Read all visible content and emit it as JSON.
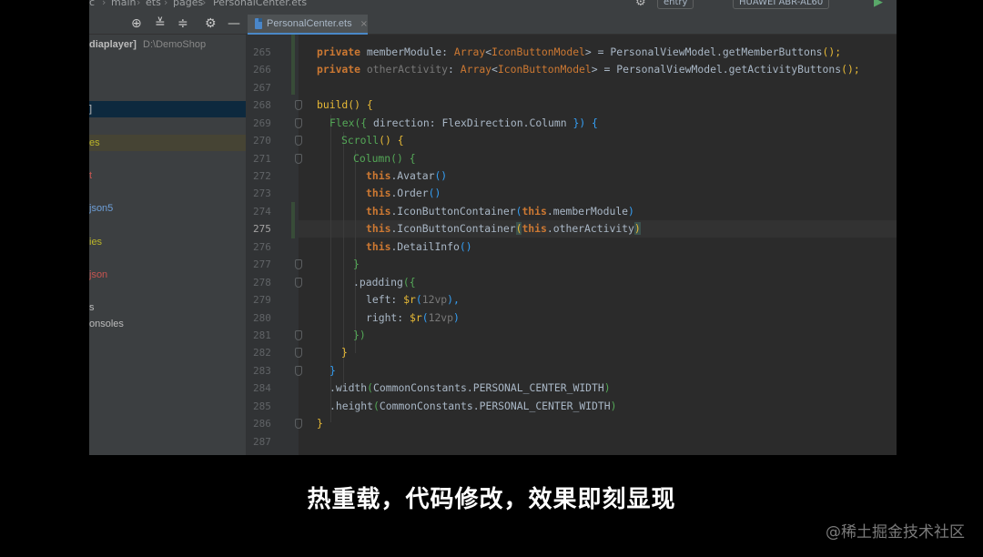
{
  "toolbar": {
    "breadcrumb": [
      "c",
      "main",
      "ets",
      "pages",
      "PersonalCenter.ets"
    ],
    "run_config": "entry",
    "device": "HUAWEI ABR-AL60"
  },
  "tabs": [
    {
      "label": "PersonalCenter.ets",
      "close": "×"
    }
  ],
  "sidebar": {
    "items": [
      {
        "label": "diaplayer]",
        "path": "D:\\DemoShop",
        "color": "#bbbbbb"
      },
      {
        "label": "]",
        "color": "#bbbbbb"
      },
      {
        "label": "es",
        "color": "#bbb529"
      },
      {
        "label": "t",
        "color": "#c75450"
      },
      {
        "label": "json5",
        "color": "#6e9fd8"
      },
      {
        "label": "ies",
        "color": "#bbb529"
      },
      {
        "label": "json",
        "color": "#c75450"
      },
      {
        "label": "s",
        "color": "#bbbbbb"
      },
      {
        "label": "onsoles",
        "color": "#bbbbbb"
      }
    ]
  },
  "editor": {
    "current_line": 275,
    "line_numbers": [
      "265",
      "266",
      "267",
      "268",
      "269",
      "270",
      "271",
      "272",
      "273",
      "274",
      "275",
      "276",
      "277",
      "278",
      "279",
      "280",
      "281",
      "282",
      "283",
      "284",
      "285",
      "286",
      "287"
    ],
    "code": {
      "l265": {
        "kw": "private",
        "name": "memberModule",
        "colon": ": ",
        "type": "Array",
        "lt": "<",
        "generic": "IconButtonModel",
        "gt": ">",
        "eq": " = ",
        "obj": "PersonalViewModel.",
        "call": "getMemberButtons",
        "end": "();"
      },
      "l266": {
        "kw": "private",
        "name": "otherActivity",
        "colon": ": ",
        "type": "Array",
        "lt": "<",
        "generic": "IconButtonModel",
        "gt": ">",
        "eq": " = ",
        "obj": "PersonalViewModel.",
        "call": "getActivityButtons",
        "end": "();"
      },
      "l268": {
        "fn": "build",
        "paren": "()",
        "brace": " {"
      },
      "l269": {
        "fn": "Flex",
        "open": "({",
        "arg": " direction: FlexDirection.Column ",
        "close": "})",
        "brace": " {"
      },
      "l270": {
        "fn": "Scroll",
        "paren": "()",
        "brace": " {"
      },
      "l271": {
        "fn": "Column",
        "paren": "()",
        "brace": " {"
      },
      "l272": {
        "kw": "this",
        "rest": ".Avatar",
        "paren": "()"
      },
      "l273": {
        "kw": "this",
        "rest": ".Order",
        "paren": "()"
      },
      "l274": {
        "kw": "this",
        "rest": ".IconButtonContainer",
        "open": "(",
        "kw2": "this",
        "arg": ".memberModule",
        "close": ")"
      },
      "l275": {
        "kw": "this",
        "rest": ".IconButtonContainer",
        "open": "(",
        "kw2": "this",
        "arg": ".otherActivity",
        "close": ")"
      },
      "l276": {
        "kw": "this",
        "rest": ".DetailInfo",
        "paren": "()"
      },
      "l277": {
        "brace": "}"
      },
      "l278": {
        "rest": ".padding",
        "open": "({"
      },
      "l279": {
        "key": "left: ",
        "dollar": "$r",
        "open": "(",
        "val": "12vp",
        "close": "),"
      },
      "l280": {
        "key": "right: ",
        "dollar": "$r",
        "open": "(",
        "val": "12vp",
        "close": ")"
      },
      "l281": {
        "brace": "})"
      },
      "l282": {
        "brace": "}"
      },
      "l283": {
        "brace": "}"
      },
      "l284": {
        "rest": ".width",
        "open": "(",
        "arg": "CommonConstants.PERSONAL_CENTER_WIDTH",
        "close": ")"
      },
      "l285": {
        "rest": ".height",
        "open": "(",
        "arg": "CommonConstants.PERSONAL_CENTER_WIDTH",
        "close": ")"
      },
      "l286": {
        "brace": "}"
      }
    }
  },
  "subtitle": "热重载，代码修改，效果即刻显现",
  "watermark": "@稀土掘金技术社区"
}
